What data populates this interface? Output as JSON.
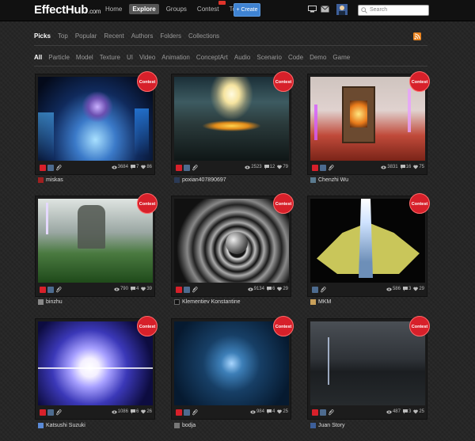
{
  "header": {
    "logo": "EffectHub",
    "logo_suffix": ".com",
    "nav": [
      "Home",
      "Explore",
      "Groups",
      "Contest",
      "Tools"
    ],
    "create_label": "+ Create",
    "search_placeholder": "Search"
  },
  "picks": [
    "Picks",
    "Top",
    "Popular",
    "Recent",
    "Authors",
    "Folders",
    "Collections"
  ],
  "categories": [
    "All",
    "Particle",
    "Model",
    "Texture",
    "UI",
    "Video",
    "Animation",
    "ConceptArt",
    "Audio",
    "Scenario",
    "Code",
    "Demo",
    "Game"
  ],
  "colors": {
    "contest_badge": "#d7202a",
    "create_button": "#3f83d2",
    "background": "#262626"
  },
  "contest_label": "Contest",
  "cards": [
    {
      "views": "3684",
      "comments": "7",
      "likes": "86",
      "author": "miskas"
    },
    {
      "views": "2523",
      "comments": "12",
      "likes": "79",
      "author": "poxian407890697"
    },
    {
      "views": "3831",
      "comments": "16",
      "likes": "75",
      "author": "Chenzhi Wu"
    },
    {
      "views": "790",
      "comments": "4",
      "likes": "39",
      "author": "binzhu"
    },
    {
      "views": "9134",
      "comments": "6",
      "likes": "29",
      "author": "Klementiev Konstantine"
    },
    {
      "views": "586",
      "comments": "3",
      "likes": "29",
      "author": "MKM"
    },
    {
      "views": "1086",
      "comments": "6",
      "likes": "26",
      "author": "Katsushi Suzuki"
    },
    {
      "views": "984",
      "comments": "4",
      "likes": "25",
      "author": "bodja"
    },
    {
      "views": "487",
      "comments": "3",
      "likes": "25",
      "author": "Juan Story"
    }
  ]
}
